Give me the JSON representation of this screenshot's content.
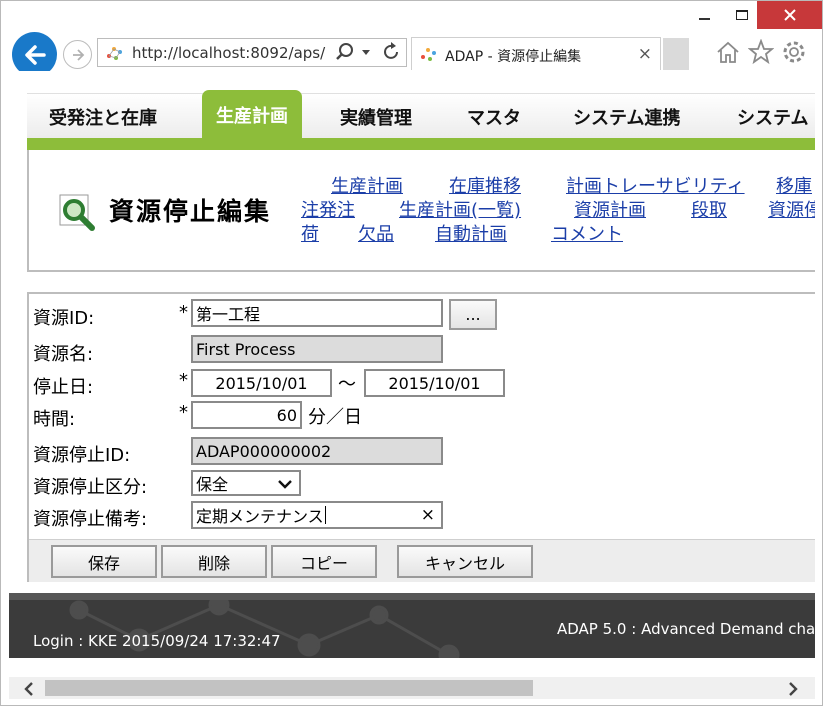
{
  "browser": {
    "url": "http://localhost:8092/aps/",
    "tab_title": "ADAP - 資源停止編集",
    "tab_close": "×"
  },
  "nav": {
    "tabs": [
      {
        "label": "受発注と在庫",
        "active": false
      },
      {
        "label": "生産計画",
        "active": true
      },
      {
        "label": "実績管理",
        "active": false
      },
      {
        "label": "マスタ",
        "active": false
      },
      {
        "label": "システム連携",
        "active": false
      },
      {
        "label": "システム",
        "active": false
      }
    ]
  },
  "page": {
    "title": "資源停止編集",
    "menu_links": {
      "row1": [
        "生産計画",
        "在庫推移",
        "計画トレーサビリティ",
        "移庫"
      ],
      "row2": [
        "注発注",
        "生産計画(一覧)",
        "資源計画",
        "段取",
        "資源停"
      ],
      "row3": [
        "荷",
        "欠品",
        "自動計画",
        "コメント"
      ]
    }
  },
  "form": {
    "resource_id": {
      "label": "資源ID:",
      "required": "*",
      "value": "第一工程",
      "lookup_label": "..."
    },
    "resource_name": {
      "label": "資源名:",
      "value": "First Process"
    },
    "stop_date": {
      "label": "停止日:",
      "required": "*",
      "from": "2015/10/01",
      "separator": "〜",
      "to": "2015/10/01"
    },
    "time": {
      "label": "時間:",
      "required": "*",
      "value": "60",
      "unit": "分／日"
    },
    "stop_id": {
      "label": "資源停止ID:",
      "value": "ADAP000000002"
    },
    "stop_type": {
      "label": "資源停止区分:",
      "value": "保全"
    },
    "stop_note": {
      "label": "資源停止備考:",
      "value": "定期メンテナンス",
      "clear": "×"
    }
  },
  "buttons": {
    "save": "保存",
    "delete": "削除",
    "copy": "コピー",
    "cancel": "キャンセル"
  },
  "footer": {
    "login": "Login : KKE 2015/09/24 17:32:47",
    "app": "ADAP 5.0 : Advanced Demand cha"
  },
  "colors": {
    "accent_green": "#8dbd3a",
    "link_blue": "#1b3ea8",
    "footer_bg": "#3b3b3b",
    "back_button": "#1979c9",
    "close_button": "#c7383a"
  }
}
